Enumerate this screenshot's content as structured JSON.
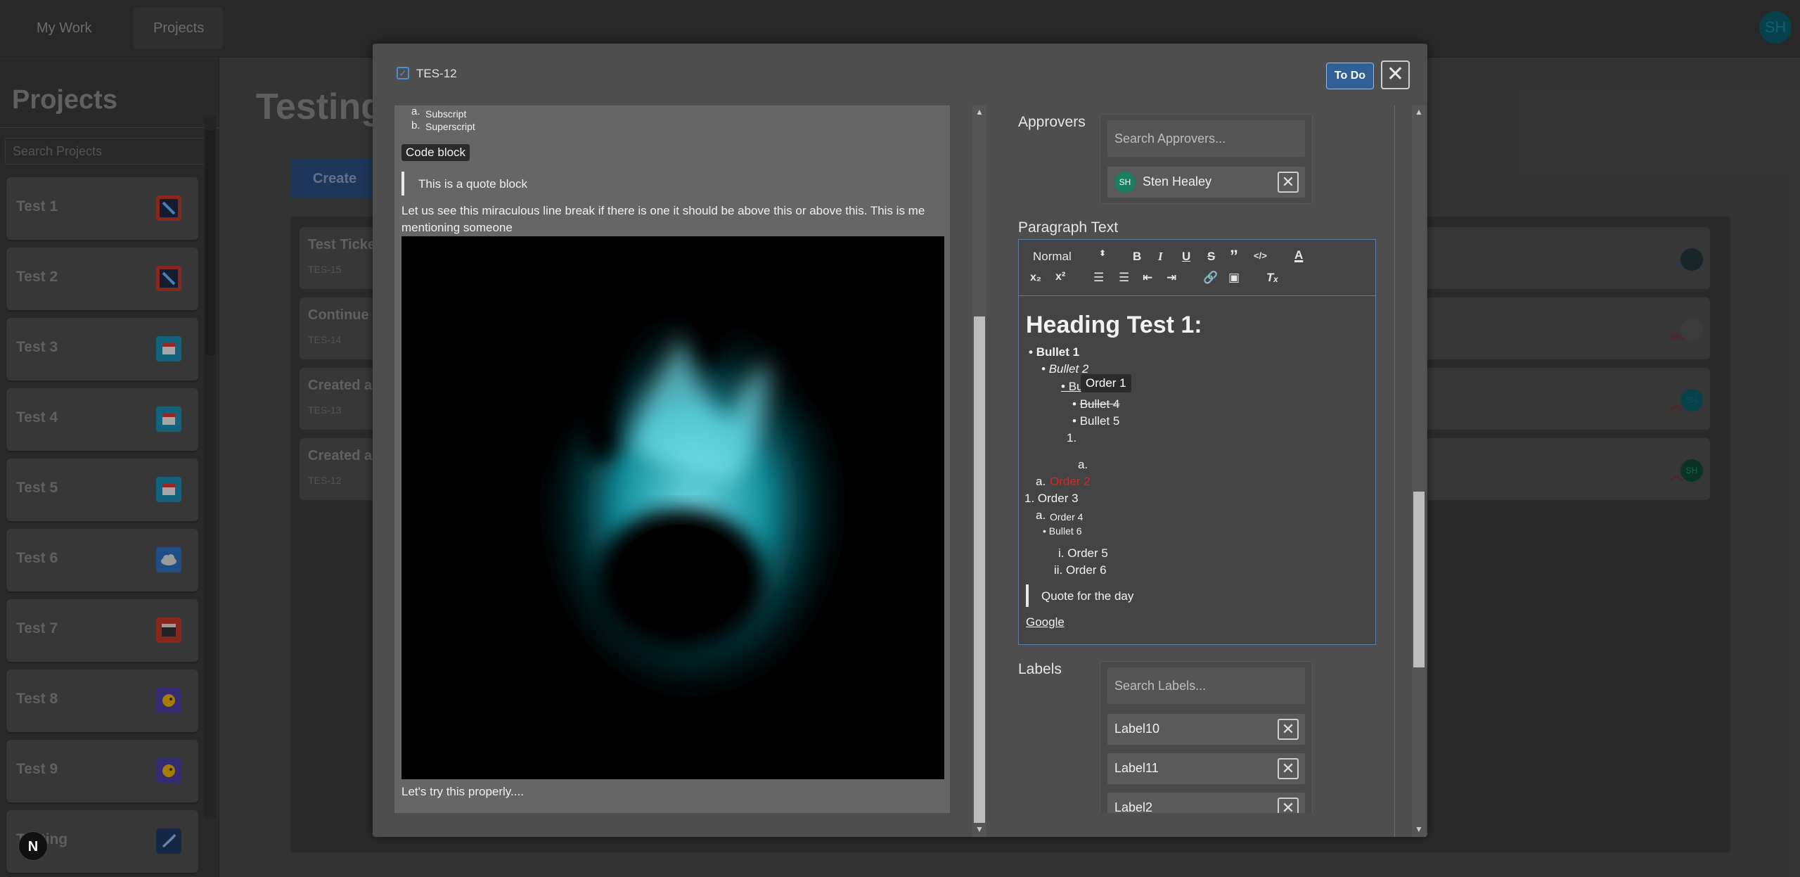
{
  "topnav": {
    "my_work": "My Work",
    "projects": "Projects",
    "user_initials": "SH"
  },
  "sidebar": {
    "title": "Projects",
    "search_placeholder": "Search Projects",
    "items": [
      {
        "label": "Test 1",
        "icon": "globe-icon"
      },
      {
        "label": "Test 2",
        "icon": "globe-icon"
      },
      {
        "label": "Test 3",
        "icon": "calendar-icon"
      },
      {
        "label": "Test 4",
        "icon": "calendar-icon"
      },
      {
        "label": "Test 5",
        "icon": "calendar-icon"
      },
      {
        "label": "Test 6",
        "icon": "cloud-icon"
      },
      {
        "label": "Test 7",
        "icon": "window-icon"
      },
      {
        "label": "Test 8",
        "icon": "fish-icon"
      },
      {
        "label": "Test 9",
        "icon": "fish-icon"
      },
      {
        "label": "Testing",
        "icon": "rocket-icon"
      }
    ]
  },
  "main": {
    "title": "Testing",
    "create_label": "Create",
    "tickets": [
      {
        "title": "Test Ticke",
        "key": "TES-15"
      },
      {
        "title": "Continue",
        "key": "TES-14"
      },
      {
        "title": "Created a",
        "key": "TES-13"
      },
      {
        "title": "Created a",
        "key": "TES-12"
      }
    ],
    "ticket_avatars": [
      "",
      "",
      "SH",
      "SH"
    ]
  },
  "n_badge": "N",
  "modal": {
    "ticket_key": "TES-12",
    "status": "To Do",
    "description": {
      "list_a": "Subscript",
      "list_b": "Superscript",
      "list_a_marker": "a.",
      "list_b_marker": "b.",
      "code_block": "Code block",
      "quote": "This is a quote block",
      "paragraph_line1": "Let us see this miraculous line break if there is one it should be above this or above this. This is me",
      "paragraph_line2": "mentioning someone",
      "footer": "Let's try this properly...."
    },
    "approvers": {
      "label": "Approvers",
      "search_placeholder": "Search Approvers...",
      "selected": [
        {
          "initials": "SH",
          "name": "Sten Healey"
        }
      ]
    },
    "paragraph": {
      "label": "Paragraph Text",
      "toolbar": {
        "heading_select": "Normal",
        "bold": "B",
        "italic": "I",
        "underline": "U",
        "strike": "S",
        "quote": "”",
        "code": "</>",
        "subscript": "x₂",
        "superscript": "x²",
        "clear": "Tₓ"
      },
      "content": {
        "heading": "Heading Test 1:",
        "bullet1": "Bullet 1",
        "bullet2": "Bullet 2",
        "bullet3": "Bullet 3",
        "bullet4": "Bullet 4",
        "bullet5": "Bullet 5",
        "order1_marker": "1.",
        "order1": "Order 1",
        "empty_a": "a.",
        "order2_marker": "a.",
        "order2": "Order 2",
        "order3": "1. Order 3",
        "order4_marker": "a.",
        "order4": "Order 4",
        "bullet6": "Bullet 6",
        "order5": "i. Order 5",
        "order6": "ii. Order 6",
        "quote": "Quote for the day",
        "link": "Google"
      }
    },
    "labels": {
      "label": "Labels",
      "search_placeholder": "Search Labels...",
      "items": [
        "Label10",
        "Label11",
        "Label2"
      ]
    }
  },
  "colors": {
    "accent": "#2f5f94",
    "danger": "#e02424",
    "approver_avatar": "#178060"
  }
}
